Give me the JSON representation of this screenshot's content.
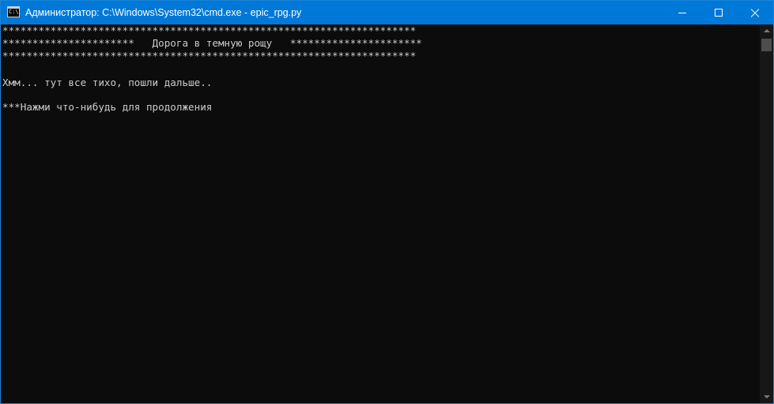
{
  "window": {
    "title": "Администратор: C:\\Windows\\System32\\cmd.exe - epic_rpg.py",
    "icon": "cmd-icon",
    "controls": [
      "minimize-icon",
      "maximize-icon",
      "close-icon"
    ],
    "accent_color": "#0078d7"
  },
  "console": {
    "background": "#0c0c0c",
    "foreground": "#cccccc",
    "lines": [
      "*********************************************************************",
      "**********************   Дорога в темную рощу   **********************",
      "*********************************************************************",
      "",
      "Хмм... тут все тихо, пошли дальше..",
      "",
      "***Нажми что-нибудь для продолжения"
    ]
  }
}
